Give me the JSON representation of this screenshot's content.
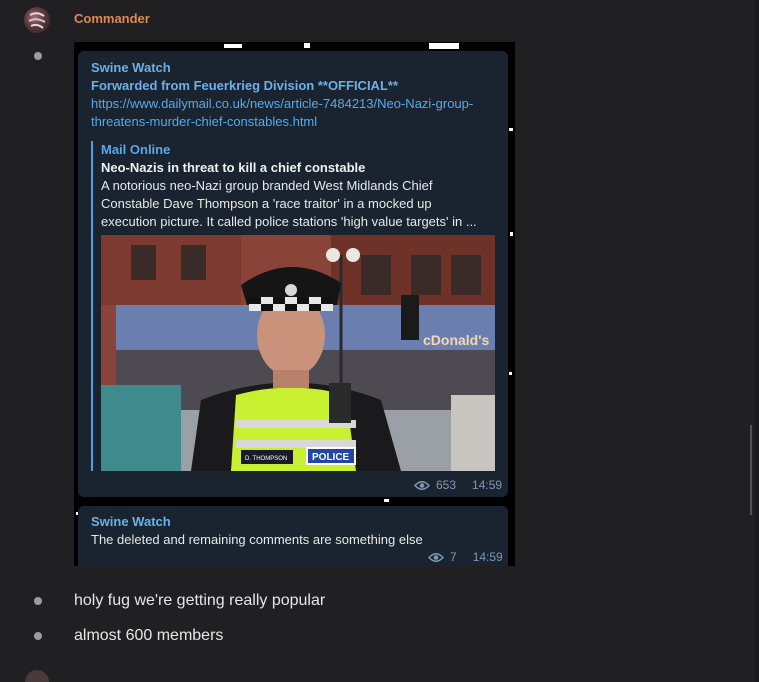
{
  "header": {
    "username": "Commander",
    "avatar_icon": "avatar-icon",
    "accent_color": "#e0884f"
  },
  "forwarded_post": {
    "channel": "Swine Watch",
    "forwarded_from": "Forwarded from Feuerkrieg Division **OFFICIAL**",
    "link_lines": [
      "https://www.dailymail.co.uk/news/article-7484213/Neo-Nazi-group-",
      "threatens-murder-chief-constables.html"
    ],
    "preview": {
      "site": "Mail Online",
      "title": "Neo-Nazis in threat to kill a chief constable",
      "description_lines": [
        "A notorious neo-Nazi group branded West Midlands Chief",
        "Constable Dave Thompson a 'race traitor' in a mocked up",
        "execution picture. It called police stations 'high value targets' in ..."
      ],
      "photo_texts": {
        "vest": "POLICE",
        "badge": "D. THOMPSON",
        "sign": "cDonald's"
      }
    },
    "views": "653",
    "time": "14:59",
    "view_icon": "eye-icon"
  },
  "second_post": {
    "channel": "Swine Watch",
    "text": "The deleted and remaining comments are something else",
    "views": "7",
    "time": "14:59",
    "view_icon": "eye-icon"
  },
  "chat_messages": [
    "holy fug we're getting really popular",
    "almost 600 members"
  ]
}
